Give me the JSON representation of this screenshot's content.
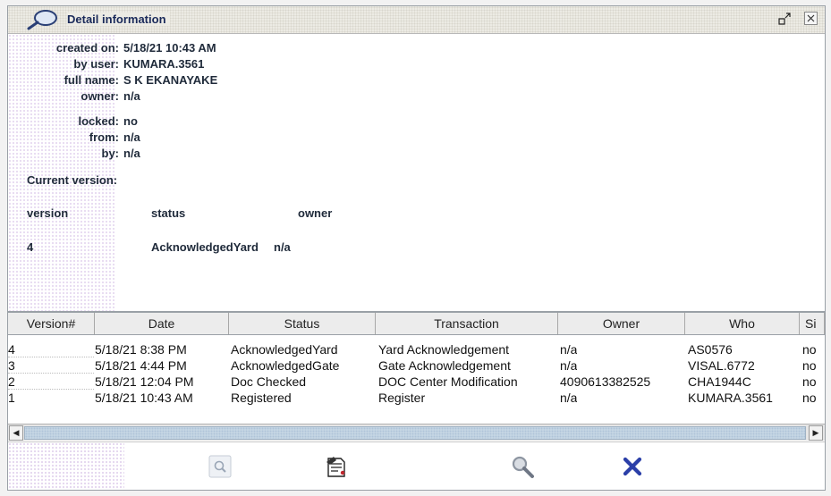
{
  "window": {
    "title": "Detail information"
  },
  "details": {
    "created_on": {
      "label": "created on:",
      "value": "5/18/21 10:43 AM"
    },
    "by_user": {
      "label": "by user:",
      "value": "KUMARA.3561"
    },
    "full_name": {
      "label": "full name:",
      "value": "S K EKANAYAKE"
    },
    "owner": {
      "label": "owner:",
      "value": "n/a"
    },
    "locked": {
      "label": "locked:",
      "value": "no"
    },
    "from": {
      "label": "from:",
      "value": "n/a"
    },
    "by": {
      "label": "by:",
      "value": "n/a"
    }
  },
  "current_version": {
    "heading": "Current version:",
    "headers": {
      "version": "version",
      "status": "status",
      "owner": "owner"
    },
    "values": {
      "version": "4",
      "status": "AcknowledgedYard",
      "owner": "n/a"
    }
  },
  "table": {
    "columns": [
      "Version#",
      "Date",
      "Status",
      "Transaction",
      "Owner",
      "Who",
      "Si"
    ],
    "rows": [
      [
        "4",
        "5/18/21 8:38 PM",
        "AcknowledgedYard",
        "Yard Acknowledgement",
        "n/a",
        "AS0576",
        "no"
      ],
      [
        "3",
        "5/18/21 4:44 PM",
        "AcknowledgedGate",
        "Gate Acknowledgement",
        "n/a",
        "VISAL.6772",
        "no"
      ],
      [
        "2",
        "5/18/21 12:04 PM",
        "Doc Checked",
        "DOC Center Modification",
        "4090613382525",
        "CHA1944C",
        "no"
      ],
      [
        "1",
        "5/18/21 10:43 AM",
        "Registered",
        "Register",
        "n/a",
        "KUMARA.3561",
        "no"
      ]
    ]
  },
  "icons": {
    "title": "magnifier-icon",
    "minimize": "restore-icon",
    "close": "close-icon",
    "bottom": [
      "view-details-icon",
      "print-document-icon",
      "search-icon",
      "cancel-icon"
    ]
  },
  "colors": {
    "title_text": "#1a2a5a",
    "cancel": "#2b3fa8"
  }
}
